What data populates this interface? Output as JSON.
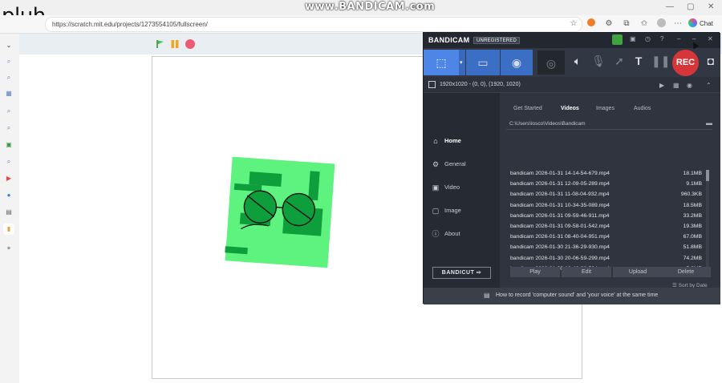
{
  "overlay_text": "pluh",
  "watermark": "www.BANDICAM.com",
  "browser": {
    "tab_title": "atch",
    "url": "https://scratch.mit.edu/projects/1273554105/fullscreen/",
    "chat_label": "Chat"
  },
  "scratch": {
    "controls": [
      "green-flag",
      "pause",
      "stop"
    ]
  },
  "bandicam": {
    "logo": "BANDICAM",
    "registration": "UNREGISTERED",
    "rec_label": "REC",
    "region_info": "1920x1020 - (0, 0), (1920, 1020)",
    "nav": [
      {
        "label": "Home",
        "icon": "home-icon"
      },
      {
        "label": "General",
        "icon": "gear-icon"
      },
      {
        "label": "Video",
        "icon": "video-icon"
      },
      {
        "label": "Image",
        "icon": "image-icon"
      },
      {
        "label": "About",
        "icon": "info-icon"
      }
    ],
    "tabs": [
      "Get Started",
      "Videos",
      "Images",
      "Audios"
    ],
    "active_tab": "Videos",
    "path": "C:\\Users\\losco\\Videos\\Bandicam",
    "files": [
      {
        "name": "bandicam 2026-01-31 14-14-54-679.mp4",
        "size": "18.1MB"
      },
      {
        "name": "bandicam 2026-01-31 12-09-05-289.mp4",
        "size": "9.1MB"
      },
      {
        "name": "bandicam 2026-01-31 11-08-04-932.mp4",
        "size": "960.3KB"
      },
      {
        "name": "bandicam 2026-01-31 10-34-35-089.mp4",
        "size": "18.5MB"
      },
      {
        "name": "bandicam 2026-01-31 09-59-46-911.mp4",
        "size": "33.2MB"
      },
      {
        "name": "bandicam 2026-01-31 09-58-01-542.mp4",
        "size": "19.3MB"
      },
      {
        "name": "bandicam 2026-01-31 08-40-04-951.mp4",
        "size": "67.0MB"
      },
      {
        "name": "bandicam 2026-01-30 21-36-29-930.mp4",
        "size": "51.8MB"
      },
      {
        "name": "bandicam 2026-01-30 20-06-59-299.mp4",
        "size": "74.2MB"
      },
      {
        "name": "bandicam 2026-01-30 18-46-28-524.mp4",
        "size": "5.8MB"
      }
    ],
    "sort_label": "Sort by Date",
    "bandicut_label": "BANDICUT",
    "actions": [
      "Play",
      "Edit",
      "Upload",
      "Delete"
    ],
    "footer_tip": "How to record 'computer sound' and 'your voice' at the same time"
  },
  "colors": {
    "accent": "#4d86e6",
    "rec": "#d6363a",
    "sprite_green": "#5ef27f",
    "sprite_dark": "#0f9e3c"
  }
}
